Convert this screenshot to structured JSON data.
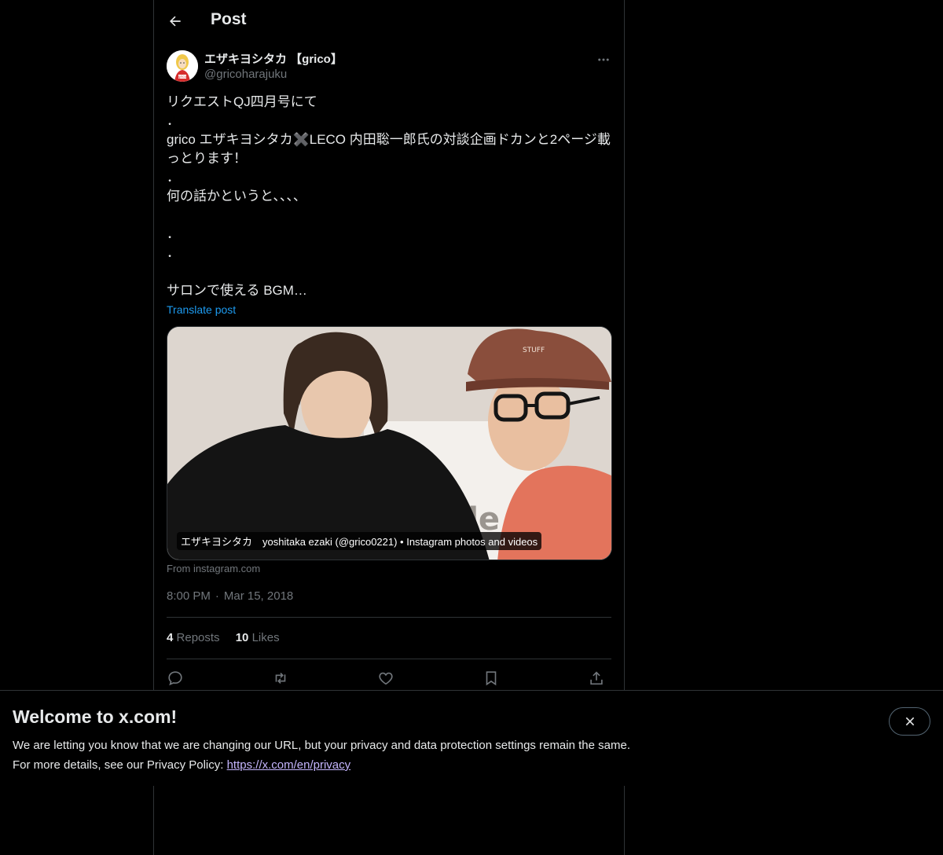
{
  "topbar": {
    "title": "Post"
  },
  "author": {
    "name": "エザキヨシタカ 【grico】",
    "handle": "@gricoharajuku",
    "avatar_text": "grico"
  },
  "post": {
    "lines": [
      "リクエストQJ四月号にて",
      "．",
      "grico エザキヨシタカ✖️LECO 内田聡一郎氏の対談企画ドカンと2ページ載",
      "っとります！",
      "．",
      "何の話かというと、、、、",
      "",
      "．",
      "．",
      "",
      "サロンで使える BGM…"
    ],
    "translate_label": "Translate post"
  },
  "card": {
    "caption": "エザキヨシタカ　yoshitaka ezaki (@grico0221) • Instagram photos and videos",
    "source": "From instagram.com",
    "wall_text": "nile",
    "cap_text": "STUFF"
  },
  "meta": {
    "time": "8:00 PM",
    "separator": "·",
    "date": "Mar 15, 2018"
  },
  "stats": {
    "reposts_count": "4",
    "reposts_label": "Reposts",
    "likes_count": "10",
    "likes_label": "Likes"
  },
  "actions": {
    "icons": [
      "reply-icon",
      "repost-icon",
      "like-icon",
      "bookmark-icon",
      "share-icon"
    ]
  },
  "banner": {
    "title": "Welcome to x.com!",
    "line1": "We are letting you know that we are changing our URL, but your privacy and data protection settings remain the same.",
    "line2_prefix": "For more details, see our Privacy Policy: ",
    "link": "https://x.com/en/privacy"
  },
  "colors": {
    "background": "#000000",
    "text": "#e7e9ea",
    "muted": "#71767b",
    "accent": "#1d9bf0",
    "border": "#2f3336",
    "link": "#c4b5fd"
  }
}
